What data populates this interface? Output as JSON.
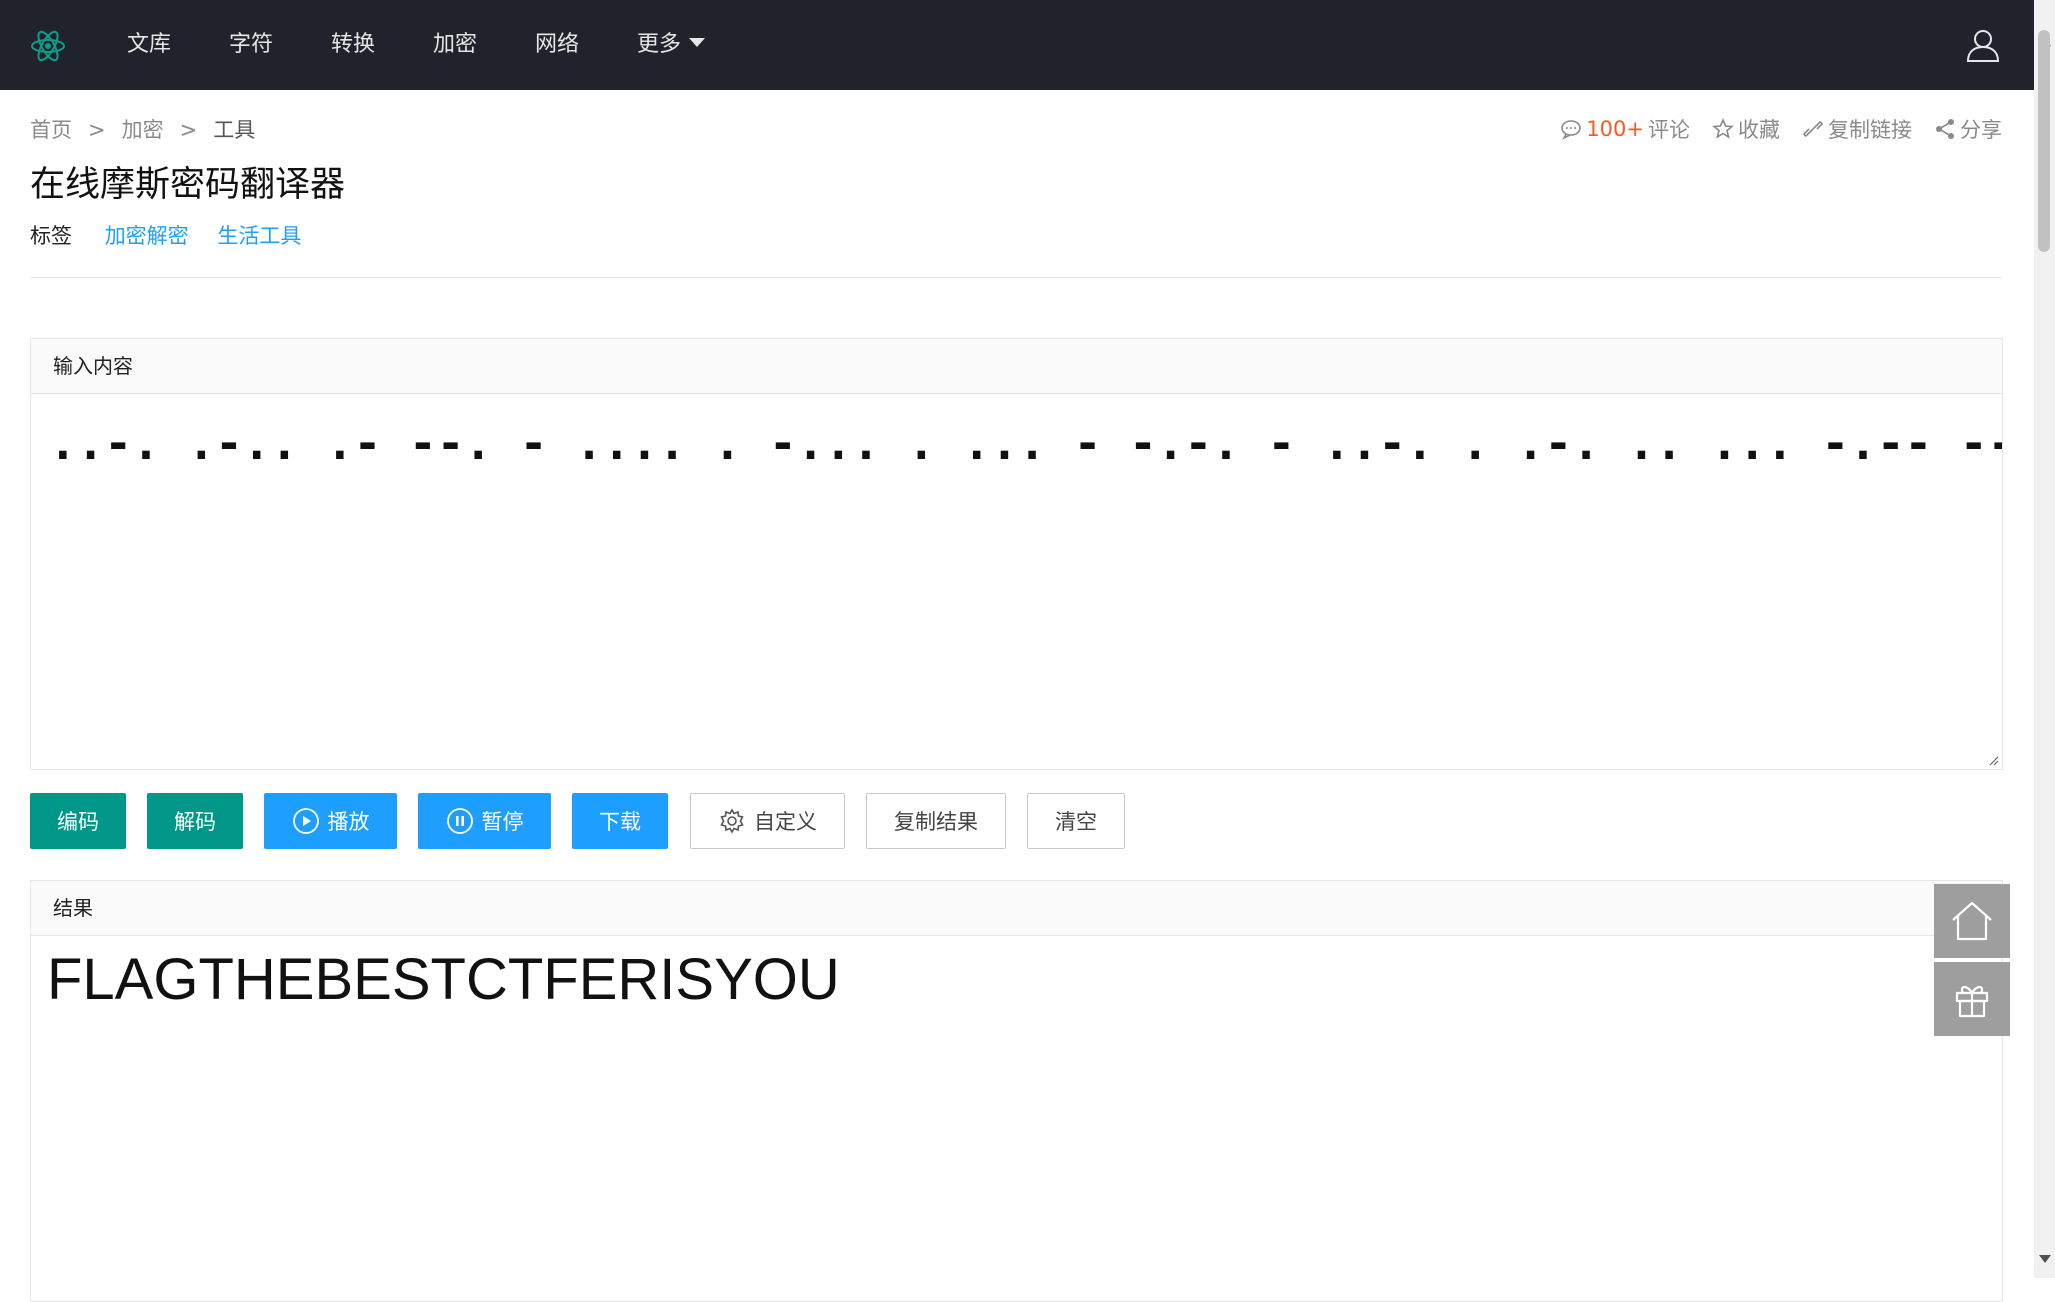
{
  "nav": {
    "logo_icon": "atom-logo-icon",
    "items": [
      {
        "label": "文库"
      },
      {
        "label": "字符"
      },
      {
        "label": "转换"
      },
      {
        "label": "加密"
      },
      {
        "label": "网络"
      },
      {
        "label": "更多"
      }
    ],
    "user_icon": "user-icon"
  },
  "breadcrumb": {
    "items": [
      "首页",
      "加密",
      "工具"
    ],
    "separator": ">"
  },
  "actions": {
    "comment_count": "100+",
    "comment_label": "评论",
    "favorite_label": "收藏",
    "copy_link_label": "复制链接",
    "share_label": "分享"
  },
  "page": {
    "title": "在线摩斯密码翻译器",
    "tags_label": "标签",
    "tags": [
      "加密解密",
      "生活工具"
    ]
  },
  "input_panel": {
    "header": "输入内容",
    "value": "..-. .-.. .- --. - .... . -... . ... - -.-. - ..-. . .-. .. ... -.-- --- ..-"
  },
  "buttons": {
    "encode": "编码",
    "decode": "解码",
    "play": "播放",
    "pause": "暂停",
    "download": "下载",
    "custom": "自定义",
    "copy_result": "复制结果",
    "clear": "清空"
  },
  "result_panel": {
    "header": "结果",
    "value": "FLAGTHEBESTCTFERISYOU"
  },
  "colors": {
    "topbar": "#20232b",
    "green": "#009688",
    "blue": "#1e9fff",
    "comment_count": "#ff5722",
    "link": "#1e9fff"
  },
  "side_tools": [
    "home-icon",
    "gift-icon"
  ]
}
